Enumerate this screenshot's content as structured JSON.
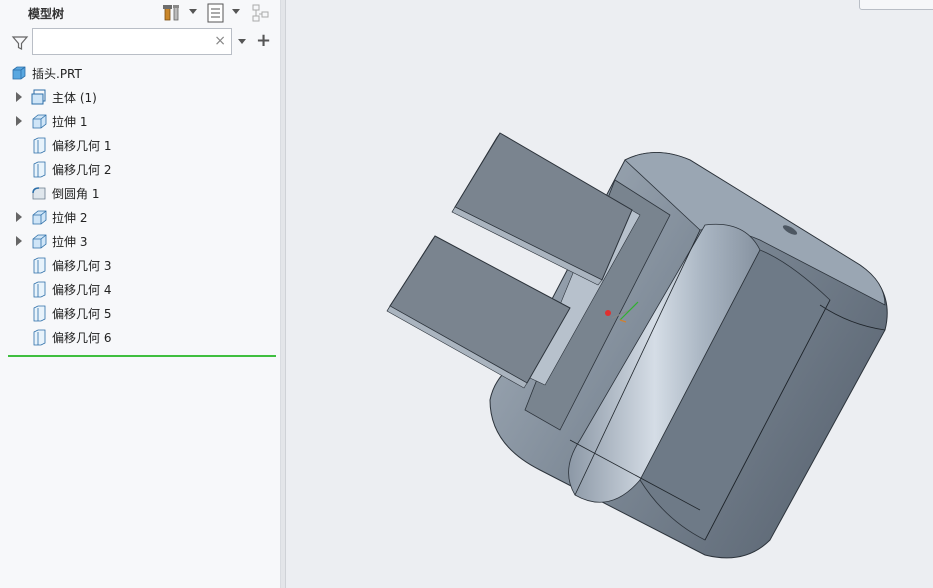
{
  "model_tree": {
    "title": "模型树",
    "search": {
      "value": "",
      "clear_symbol": "×"
    },
    "add_symbol": "+",
    "root": {
      "label": "插头.PRT",
      "icon": "part-icon"
    },
    "items": [
      {
        "label": "主体 (1)",
        "icon": "body-icon",
        "expandable": true
      },
      {
        "label": "拉伸 1",
        "icon": "extrude-icon",
        "expandable": true
      },
      {
        "label": "偏移几何 1",
        "icon": "offset-geometry-icon",
        "expandable": false
      },
      {
        "label": "偏移几何 2",
        "icon": "offset-geometry-icon",
        "expandable": false
      },
      {
        "label": "倒圆角 1",
        "icon": "round-icon",
        "expandable": false
      },
      {
        "label": "拉伸 2",
        "icon": "extrude-icon",
        "expandable": true
      },
      {
        "label": "拉伸 3",
        "icon": "extrude-icon",
        "expandable": true
      },
      {
        "label": "偏移几何 3",
        "icon": "offset-geometry-icon",
        "expandable": false
      },
      {
        "label": "偏移几何 4",
        "icon": "offset-geometry-icon",
        "expandable": false
      },
      {
        "label": "偏移几何 5",
        "icon": "offset-geometry-icon",
        "expandable": false
      },
      {
        "label": "偏移几何 6",
        "icon": "offset-geometry-icon",
        "expandable": false
      }
    ]
  },
  "toolbar_icons": [
    "settings-tools-icon",
    "show-options-icon",
    "tree-filter-icon"
  ],
  "viewport": {
    "model": "plug-3d-model",
    "background": "#eceef2"
  },
  "colors": {
    "insert_line": "#3fbf3f",
    "model_fill": "#8a96a4"
  }
}
